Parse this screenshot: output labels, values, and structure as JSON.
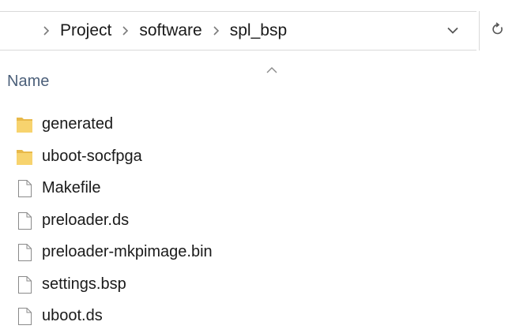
{
  "address_bar": {
    "breadcrumbs": [
      "Project",
      "software",
      "spl_bsp"
    ],
    "separator_icon": "chevron-right-icon",
    "dropdown_icon": "chevron-down-icon",
    "refresh_icon": "refresh-icon"
  },
  "column_header": {
    "name_label": "Name",
    "sort_indicator": "sort-ascending-icon"
  },
  "files": [
    {
      "name": "generated",
      "type": "folder"
    },
    {
      "name": "uboot-socfpga",
      "type": "folder"
    },
    {
      "name": "Makefile",
      "type": "file"
    },
    {
      "name": "preloader.ds",
      "type": "file"
    },
    {
      "name": "preloader-mkpimage.bin",
      "type": "file"
    },
    {
      "name": "settings.bsp",
      "type": "file"
    },
    {
      "name": "uboot.ds",
      "type": "file"
    }
  ],
  "colors": {
    "folder": "#f7d36e",
    "folder_dark": "#e8b94a",
    "file_outline": "#8a8a8a",
    "header_text": "#4c607a"
  }
}
